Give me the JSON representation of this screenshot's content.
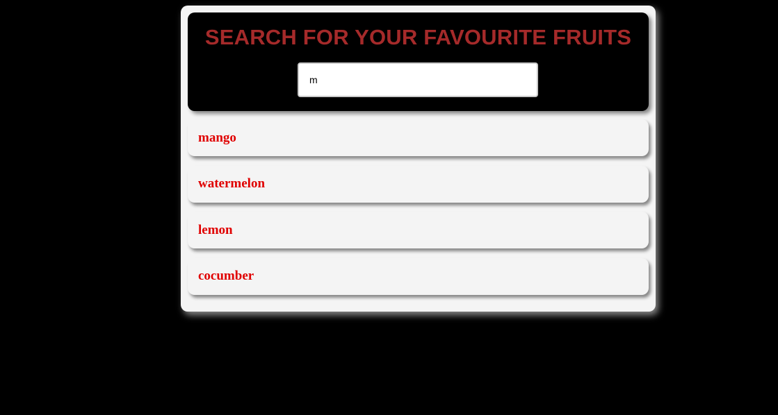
{
  "header": {
    "title": "SEARCH FOR YOUR FAVOURITE FRUITS"
  },
  "search": {
    "value": "m",
    "placeholder": ""
  },
  "results": [
    {
      "label": "mango"
    },
    {
      "label": "watermelon"
    },
    {
      "label": "lemon"
    },
    {
      "label": "cocumber"
    }
  ],
  "colors": {
    "page_background": "#000000",
    "card_background": "#f4f4f4",
    "title": "#a52a2a",
    "result_text": "#e00000"
  }
}
